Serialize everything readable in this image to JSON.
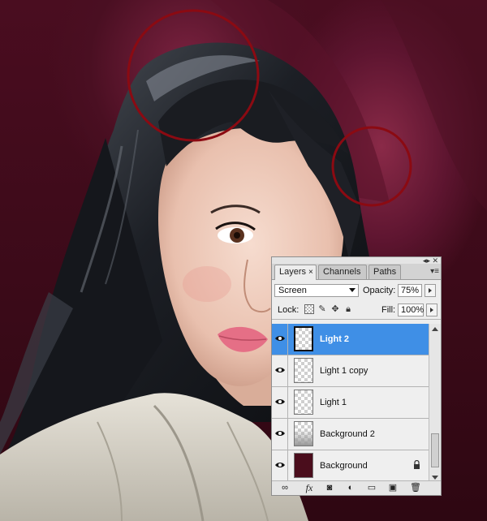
{
  "canvas": {
    "description_colors": {
      "background": "#3a0a18",
      "ring": "#8b0a12"
    }
  },
  "layers_panel": {
    "tabs": [
      {
        "label": "Layers",
        "close": "×"
      },
      {
        "label": "Channels"
      },
      {
        "label": "Paths"
      }
    ],
    "blend_mode": "Screen",
    "opacity_label": "Opacity:",
    "opacity_value": "75%",
    "lock_label": "Lock:",
    "fill_label": "Fill:",
    "fill_value": "100%",
    "layers": [
      {
        "name": "Light 2",
        "selected": true,
        "thumb": "transparent"
      },
      {
        "name": "Light 1 copy",
        "selected": false,
        "thumb": "transparent"
      },
      {
        "name": "Light 1",
        "selected": false,
        "thumb": "transparent"
      },
      {
        "name": "Background 2",
        "selected": false,
        "thumb": "gradient"
      },
      {
        "name": "Background",
        "selected": false,
        "thumb": "dark",
        "locked": true
      }
    ],
    "bottom_icons": [
      "link-icon",
      "fx-icon",
      "mask-icon",
      "adjustment-icon",
      "folder-icon",
      "new-layer-icon",
      "trash-icon"
    ],
    "fx_label": "fx"
  }
}
